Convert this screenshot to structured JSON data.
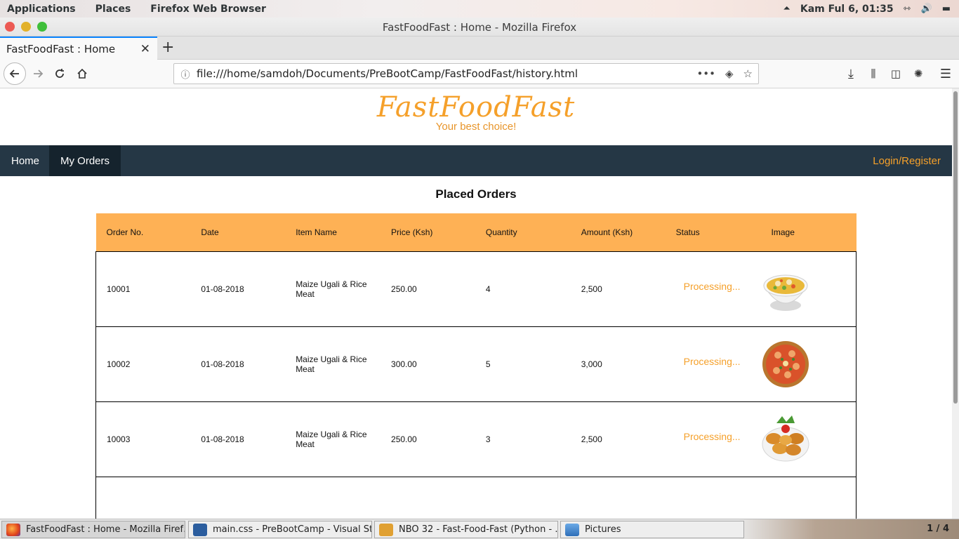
{
  "system_bar": {
    "applications": "Applications",
    "places": "Places",
    "active_app": "Firefox Web Browser",
    "clock": "Kam Ful  6, 01:35"
  },
  "window": {
    "title": "FastFoodFast : Home - Mozilla Firefox"
  },
  "tabs": [
    {
      "label": "FastFoodFast : Home"
    }
  ],
  "address_bar": {
    "url": "file:///home/samdoh/Documents/PreBootCamp/FastFoodFast/history.html"
  },
  "site": {
    "brand": "FastFoodFast",
    "tagline": "Your best choice!",
    "nav": {
      "home": "Home",
      "my_orders": "My Orders",
      "login": "Login/Register"
    },
    "page_title": "Placed Orders"
  },
  "orders_table": {
    "headers": [
      "Order No.",
      "Date",
      "Item Name",
      "Price (Ksh)",
      "Quantity",
      "Amount (Ksh)",
      "Status",
      "Image"
    ],
    "rows": [
      {
        "order_no": "10001",
        "date": "01-08-2018",
        "item": "Maize Ugali & Rice Meat",
        "price": "250.00",
        "quantity": "4",
        "amount": "2,500",
        "status": "Processing...",
        "image": "soup-bowl"
      },
      {
        "order_no": "10002",
        "date": "01-08-2018",
        "item": "Maize Ugali & Rice Meat",
        "price": "300.00",
        "quantity": "5",
        "amount": "3,000",
        "status": "Processing...",
        "image": "pizza"
      },
      {
        "order_no": "10003",
        "date": "01-08-2018",
        "item": "Maize Ugali & Rice Meat",
        "price": "250.00",
        "quantity": "3",
        "amount": "2,500",
        "status": "Processing...",
        "image": "fried-dumplings"
      }
    ]
  },
  "taskbar": {
    "items": [
      {
        "label": "FastFoodFast : Home - Mozilla Firef…",
        "icon": "firefox-icon"
      },
      {
        "label": "main.css - PreBootCamp - Visual St…",
        "icon": "vscode-icon"
      },
      {
        "label": "NBO 32 - Fast-Food-Fast (Python - …",
        "icon": "sublime-icon"
      },
      {
        "label": "Pictures",
        "icon": "file-manager-icon"
      }
    ],
    "workspace": "1 / 4"
  },
  "colors": {
    "accent": "#f5a02a",
    "nav_bg": "#253745",
    "table_header": "#feb155"
  }
}
